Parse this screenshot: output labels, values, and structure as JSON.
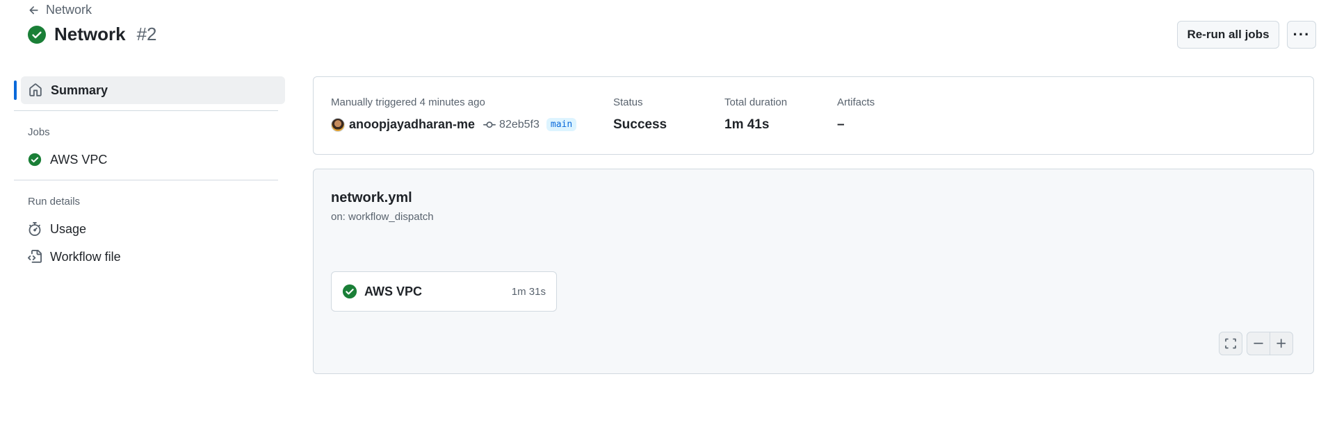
{
  "header": {
    "back_label": "Network",
    "title": "Network",
    "run_number": "#2",
    "rerun_label": "Re-run all jobs",
    "more_label": "···"
  },
  "sidebar": {
    "summary_label": "Summary",
    "jobs_heading": "Jobs",
    "jobs": [
      {
        "label": "AWS VPC",
        "status": "success"
      }
    ],
    "run_details_heading": "Run details",
    "usage_label": "Usage",
    "workflow_file_label": "Workflow file"
  },
  "summary": {
    "trigger_text": "Manually triggered 4 minutes ago",
    "actor": "anoopjayadharan-me",
    "commit": "82eb5f3",
    "branch": "main",
    "status_label": "Status",
    "status_value": "Success",
    "duration_label": "Total duration",
    "duration_value": "1m 41s",
    "artifacts_label": "Artifacts",
    "artifacts_value": "–"
  },
  "workflow": {
    "file_name": "network.yml",
    "trigger": "on: workflow_dispatch",
    "jobs": [
      {
        "name": "AWS VPC",
        "duration": "1m 31s",
        "status": "success"
      }
    ]
  },
  "zoom_controls": {
    "fullscreen_icon": "fullscreen-icon",
    "zoom_out_icon": "minus-icon",
    "zoom_in_icon": "plus-icon"
  },
  "colors": {
    "success": "#1a7f37",
    "accent": "#0969da"
  }
}
